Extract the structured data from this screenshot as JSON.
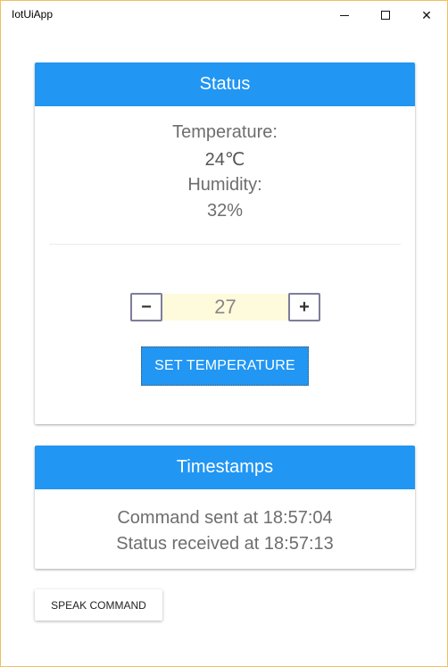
{
  "window": {
    "title": "IotUiApp",
    "minimize_icon": "minimize-icon",
    "maximize_icon": "maximize-icon",
    "close_icon": "close-icon",
    "close_glyph": "✕"
  },
  "status": {
    "header": "Status",
    "temperature_label": "Temperature:",
    "temperature_value": "24℃",
    "humidity_label": "Humidity:",
    "humidity_value": "32%",
    "stepper": {
      "decrement_label": "−",
      "increment_label": "+",
      "value": "27"
    },
    "set_button_label": "SET TEMPERATURE"
  },
  "timestamps": {
    "header": "Timestamps",
    "command_sent": "Command sent at 18:57:04",
    "status_received": "Status received at 18:57:13"
  },
  "speak_button_label": "SPEAK COMMAND",
  "colors": {
    "accent": "#2196f3",
    "input_bg": "#fdfbdc"
  }
}
